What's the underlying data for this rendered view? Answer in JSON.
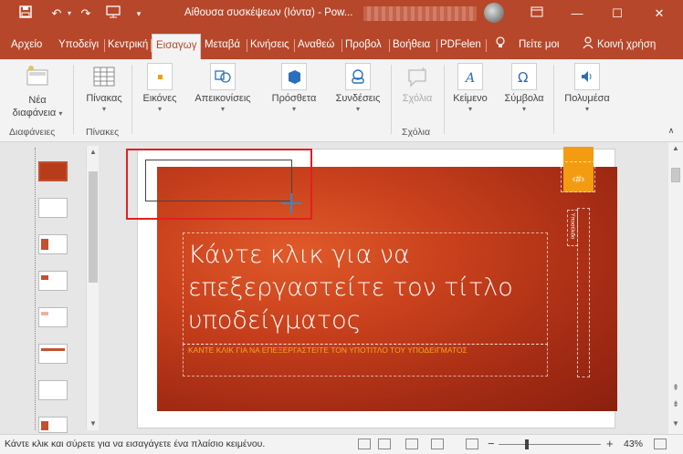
{
  "titlebar": {
    "save_icon": "save-icon",
    "title": "Αίθουσα συσκέψεων (Ιόντα)  -  Pow...",
    "undo_icon": "undo-icon",
    "redo_icon": "redo-icon",
    "start_icon": "presentation-start-icon",
    "customize_icon": "chevron-down-icon",
    "ribbon_options_icon": "ribbon-options-icon",
    "minimize": "—",
    "maximize": "☐",
    "close": "✕"
  },
  "tabs": [
    {
      "label": "Αρχείο"
    },
    {
      "label": "Υποδείγι"
    },
    {
      "label": "Κεντρική"
    },
    {
      "label": "Εισαγωγ"
    },
    {
      "label": "Μεταβά"
    },
    {
      "label": "Κινήσεις"
    },
    {
      "label": "Αναθεώ"
    },
    {
      "label": "Προβολ"
    },
    {
      "label": "Βοήθεια"
    },
    {
      "label": "PDFelen"
    },
    {
      "label": "Πείτε μοι"
    },
    {
      "label": "Κοινή χρήση"
    }
  ],
  "ribbon": {
    "new_slide": {
      "label1": "Νέα",
      "label2": "διαφάνεια"
    },
    "group_slides": "Διαφάνειες",
    "table": {
      "label": "Πίνακας"
    },
    "group_tables": "Πίνακες",
    "images": {
      "label": "Εικόνες"
    },
    "illustrations": {
      "label": "Απεικονίσεις"
    },
    "addins": {
      "label": "Πρόσθετα"
    },
    "links": {
      "label": "Συνδέσεις"
    },
    "comments": {
      "label": "Σχόλια"
    },
    "group_comments": "Σχόλια",
    "text": {
      "label": "Κείμενο"
    },
    "symbols": {
      "label": "Σύμβολα"
    },
    "media": {
      "label": "Πολυμέσα"
    }
  },
  "slide": {
    "title": "Κάντε κλικ για να επεξεργαστείτε τον τίτλο υποδείγματος",
    "subtitle": "ΚΑΝΤΕ ΚΛΙΚ ΓΙΑ ΝΑ ΕΠΕΞΕΡΓΑΣΤΕΙΤΕ ΤΟΝ ΥΠΟΤΙΤΛΟ ΤΟΥ ΥΠΟΔΕΙΓΜΑΤΟΣ",
    "slide_number": "‹#›",
    "date": "Υποσέλιδο"
  },
  "status": {
    "message": "Κάντε κλικ και σύρετε για να εισαγάγετε ένα πλαίσιο κειμένου.",
    "zoom_minus": "−",
    "zoom_plus": "+",
    "zoom": "43%",
    "zoom_level": 0.43
  },
  "colors": {
    "accent": "#b7472a",
    "slide_orange": "#f39c12",
    "selection_red": "#e21f1f",
    "crosshair": "#2a8ec9"
  }
}
